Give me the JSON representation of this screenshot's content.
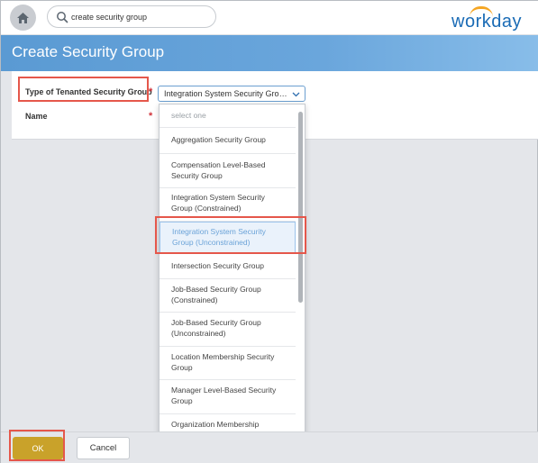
{
  "app": {
    "logo_text": "workday",
    "logo_color": "#1a6bb5",
    "logo_accent": "#f5a623"
  },
  "topbar": {
    "home_icon": "home-icon",
    "search": {
      "value": "create security group",
      "icon": "search-icon"
    }
  },
  "page": {
    "title": "Create Security Group"
  },
  "form": {
    "type_label": "Type of Tenanted Security Group",
    "type_value": "Integration System Security Grou...",
    "name_label": "Name",
    "required_marker": "*"
  },
  "dropdown": {
    "items": [
      {
        "label": "select one"
      },
      {
        "label": "Aggregation Security Group"
      },
      {
        "label": "Compensation Level-Based Security Group"
      },
      {
        "label": "Integration System Security Group (Constrained)"
      },
      {
        "label": "Integration System Security Group (Unconstrained)",
        "selected": true
      },
      {
        "label": "Intersection Security Group"
      },
      {
        "label": "Job-Based Security Group (Constrained)"
      },
      {
        "label": "Job-Based Security Group (Unconstrained)"
      },
      {
        "label": "Location Membership Security Group"
      },
      {
        "label": "Manager Level-Based Security Group"
      },
      {
        "label": "Organization Membership Security Group (Constrained)"
      }
    ]
  },
  "actions": {
    "ok_label": "OK",
    "cancel_label": "Cancel"
  },
  "colors": {
    "banner": "#6aa6dc",
    "ok_button": "#c9a22a",
    "highlight": "#e5574b",
    "required": "#d0323a"
  }
}
